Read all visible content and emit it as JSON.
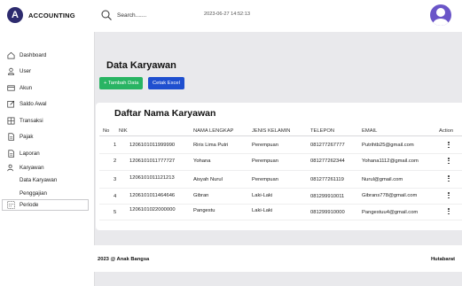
{
  "brand": {
    "logo_letter": "A",
    "name": "ACCOUNTING"
  },
  "sidebar": {
    "items": [
      {
        "label": "Dashboard",
        "icon": "home-icon"
      },
      {
        "label": "User",
        "icon": "user-icon"
      },
      {
        "label": "Akun",
        "icon": "credit-card-icon"
      },
      {
        "label": "Saldo Awal",
        "icon": "edit-icon"
      },
      {
        "label": "Transaksi",
        "icon": "grid-icon"
      },
      {
        "label": "Pajak",
        "icon": "document-icon"
      },
      {
        "label": "Laporan",
        "icon": "document-icon"
      },
      {
        "label": "Karyawan",
        "icon": "users-icon"
      }
    ],
    "sub_items": [
      "Data Karyawan",
      "Penggajian"
    ],
    "active_item": {
      "label": "Periode",
      "icon": "calendar-icon"
    }
  },
  "topbar": {
    "search_placeholder": "Search.......",
    "datetime": "2023-06-27 14:52:13"
  },
  "page": {
    "title": "Data Karyawan",
    "add_button": "+ Tambah Data",
    "excel_button": "Cetak Excel"
  },
  "table": {
    "title": "Daftar Nama Karyawan",
    "columns": [
      "No",
      "NIK",
      "NAMA LENGKAP",
      "JENIS KELAMIN",
      "TELEPON",
      "EMAIL",
      "Action"
    ],
    "rows": [
      {
        "no": "1",
        "nik": "1206101011999990",
        "nama": "Riris Lima Putri",
        "jk": "Perempuan",
        "telepon": "081277267777",
        "email": "Putrihtb25@gmail.com"
      },
      {
        "no": "2",
        "nik": "1206101011777727",
        "nama": "Yohana",
        "jk": "Perempuan",
        "telepon": "081277262344",
        "email": "Yohana1112@gmail.com"
      },
      {
        "no": "3",
        "nik": "1206101011121213",
        "nama": "Aisyah Nurul",
        "jk": "Perempuan",
        "telepon": "081277261119",
        "email": "Nurul@gmail.com"
      },
      {
        "no": "4",
        "nik": "1206101011464646",
        "nama": "Gibran",
        "jk": "Laki-Laki",
        "telepon": "081299910011",
        "email": "Gibrans778@gmail.com"
      },
      {
        "no": "5",
        "nik": "1206101022000000",
        "nama": "Pangestu",
        "jk": "Laki-Laki",
        "telepon": "081299910000",
        "email": "Pangestuu4@gmail.com"
      }
    ]
  },
  "footer": {
    "left": "2023 @ Anak Bangsa",
    "right": "Hutabarat"
  },
  "colors": {
    "brand": "#2d2b6e",
    "add_button": "#28b463",
    "excel_button": "#1f4fcf",
    "avatar": "#6a55c8",
    "background": "#e9e9ec"
  }
}
